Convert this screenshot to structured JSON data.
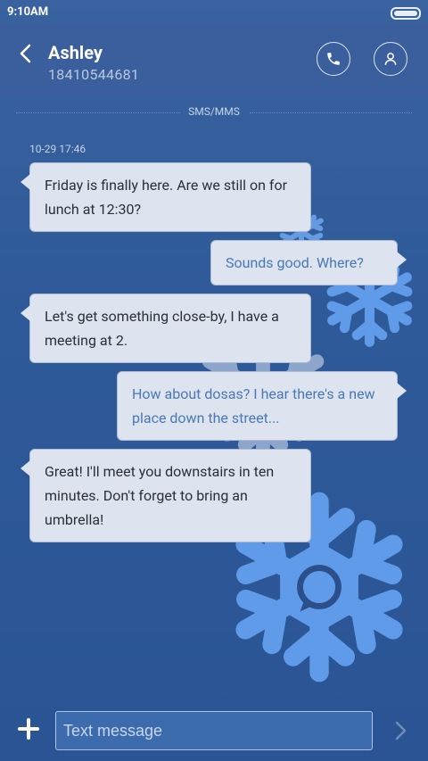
{
  "status_bar": {
    "time": "9:10AM"
  },
  "header": {
    "contact_name": "Ashley",
    "contact_number": "18410544681"
  },
  "thread": {
    "channel_label": "SMS/MMS",
    "timestamp": "10-29 17:46",
    "messages": [
      {
        "direction": "incoming",
        "text": "Friday is finally here. Are we still on for lunch at 12:30?"
      },
      {
        "direction": "outgoing",
        "text": "Sounds good. Where?"
      },
      {
        "direction": "incoming",
        "text": "Let's get something close-by, I have a meeting at 2."
      },
      {
        "direction": "outgoing",
        "text": "How about dosas? I hear there's a new place down the street..."
      },
      {
        "direction": "incoming",
        "text": "Great! I'll meet you downstairs in ten minutes. Don't forget to bring an umbrella!"
      }
    ]
  },
  "composer": {
    "placeholder": "Text message"
  },
  "colors": {
    "header_bg": "#3a5f9c",
    "bubble_bg": "#dde4ef",
    "outgoing_text": "#4a78b5",
    "snowflake": "#5f9be8"
  }
}
